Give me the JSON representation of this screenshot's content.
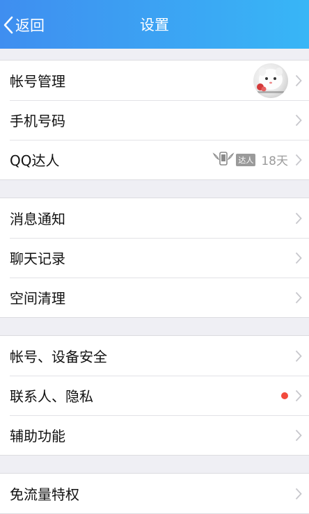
{
  "navbar": {
    "back_label": "返回",
    "title": "设置"
  },
  "groups": [
    {
      "items": [
        {
          "label": "帐号管理"
        },
        {
          "label": "手机号码"
        },
        {
          "label": "QQ达人",
          "badge_text": "达人",
          "days": "18天"
        }
      ]
    },
    {
      "items": [
        {
          "label": "消息通知"
        },
        {
          "label": "聊天记录"
        },
        {
          "label": "空间清理"
        }
      ]
    },
    {
      "items": [
        {
          "label": "帐号、设备安全"
        },
        {
          "label": "联系人、隐私",
          "has_red_dot": true
        },
        {
          "label": "辅助功能"
        }
      ]
    },
    {
      "items": [
        {
          "label": "免流量特权"
        }
      ]
    }
  ],
  "colors": {
    "navbar_start": "#3f8ef0",
    "navbar_end": "#38b6f6",
    "red_dot": "#f24a3d"
  }
}
